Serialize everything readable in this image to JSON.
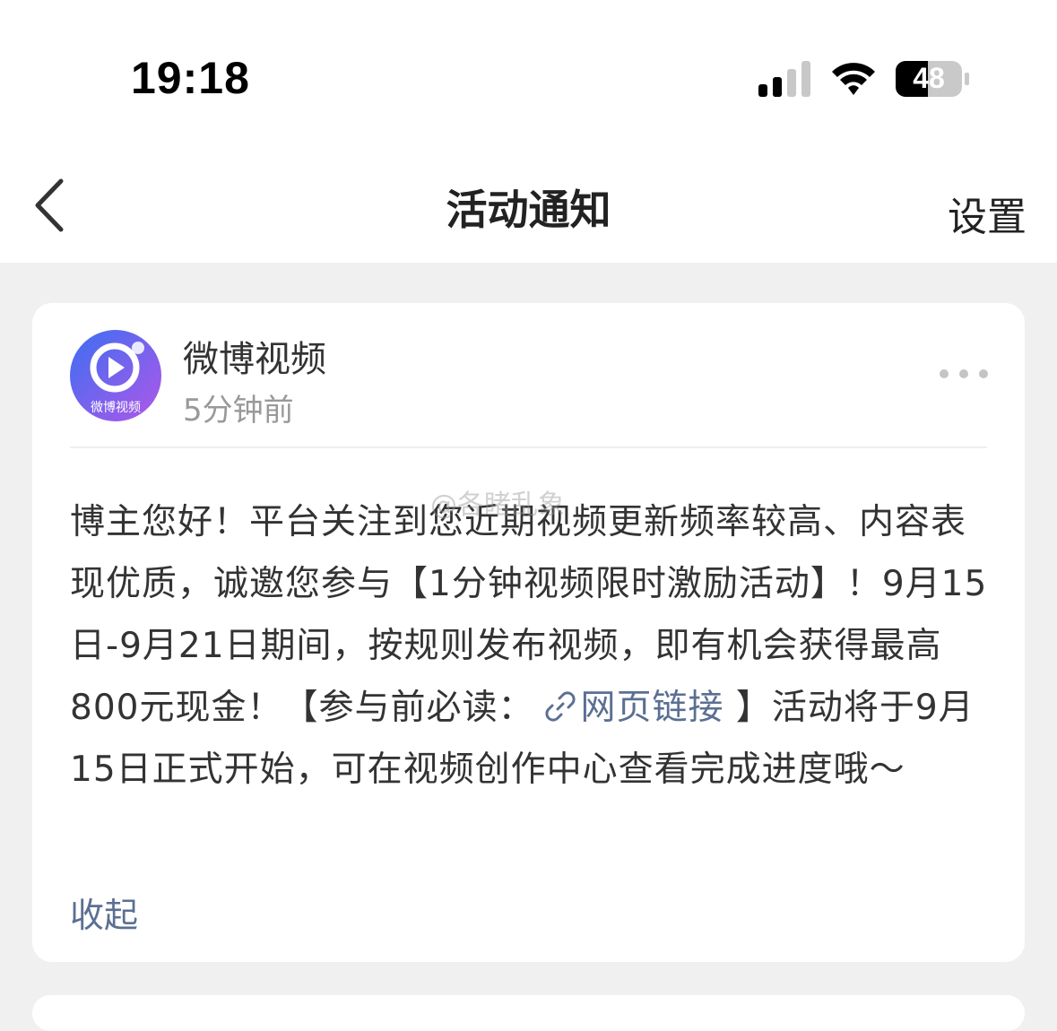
{
  "status_bar": {
    "time": "19:18",
    "battery": "48"
  },
  "nav": {
    "title": "活动通知",
    "settings_label": "设置",
    "back_icon": "chevron-left-icon"
  },
  "card": {
    "sender": "微博视频",
    "avatar_text": "微博视频",
    "time_ago": "5分钟前",
    "message_part1": "博主您好！平台关注到您近期视频更新频率较高、内容表现优质，诚邀您参与【1分钟视频限时激励活动】！9月15日-9月21日期间，按规则发布视频，即有机会获得最高800元现金！【参与前必读：",
    "link_text": "网页链接",
    "message_part2": " 】活动将于9月15日正式开始，可在视频创作中心查看完成进度哦～",
    "collapse_label": "收起"
  },
  "watermark": "@各睹乱象",
  "colors": {
    "link": "#5b6f92",
    "avatar_gradient_start": "#3b6ff2",
    "avatar_gradient_end": "#b057e8"
  }
}
